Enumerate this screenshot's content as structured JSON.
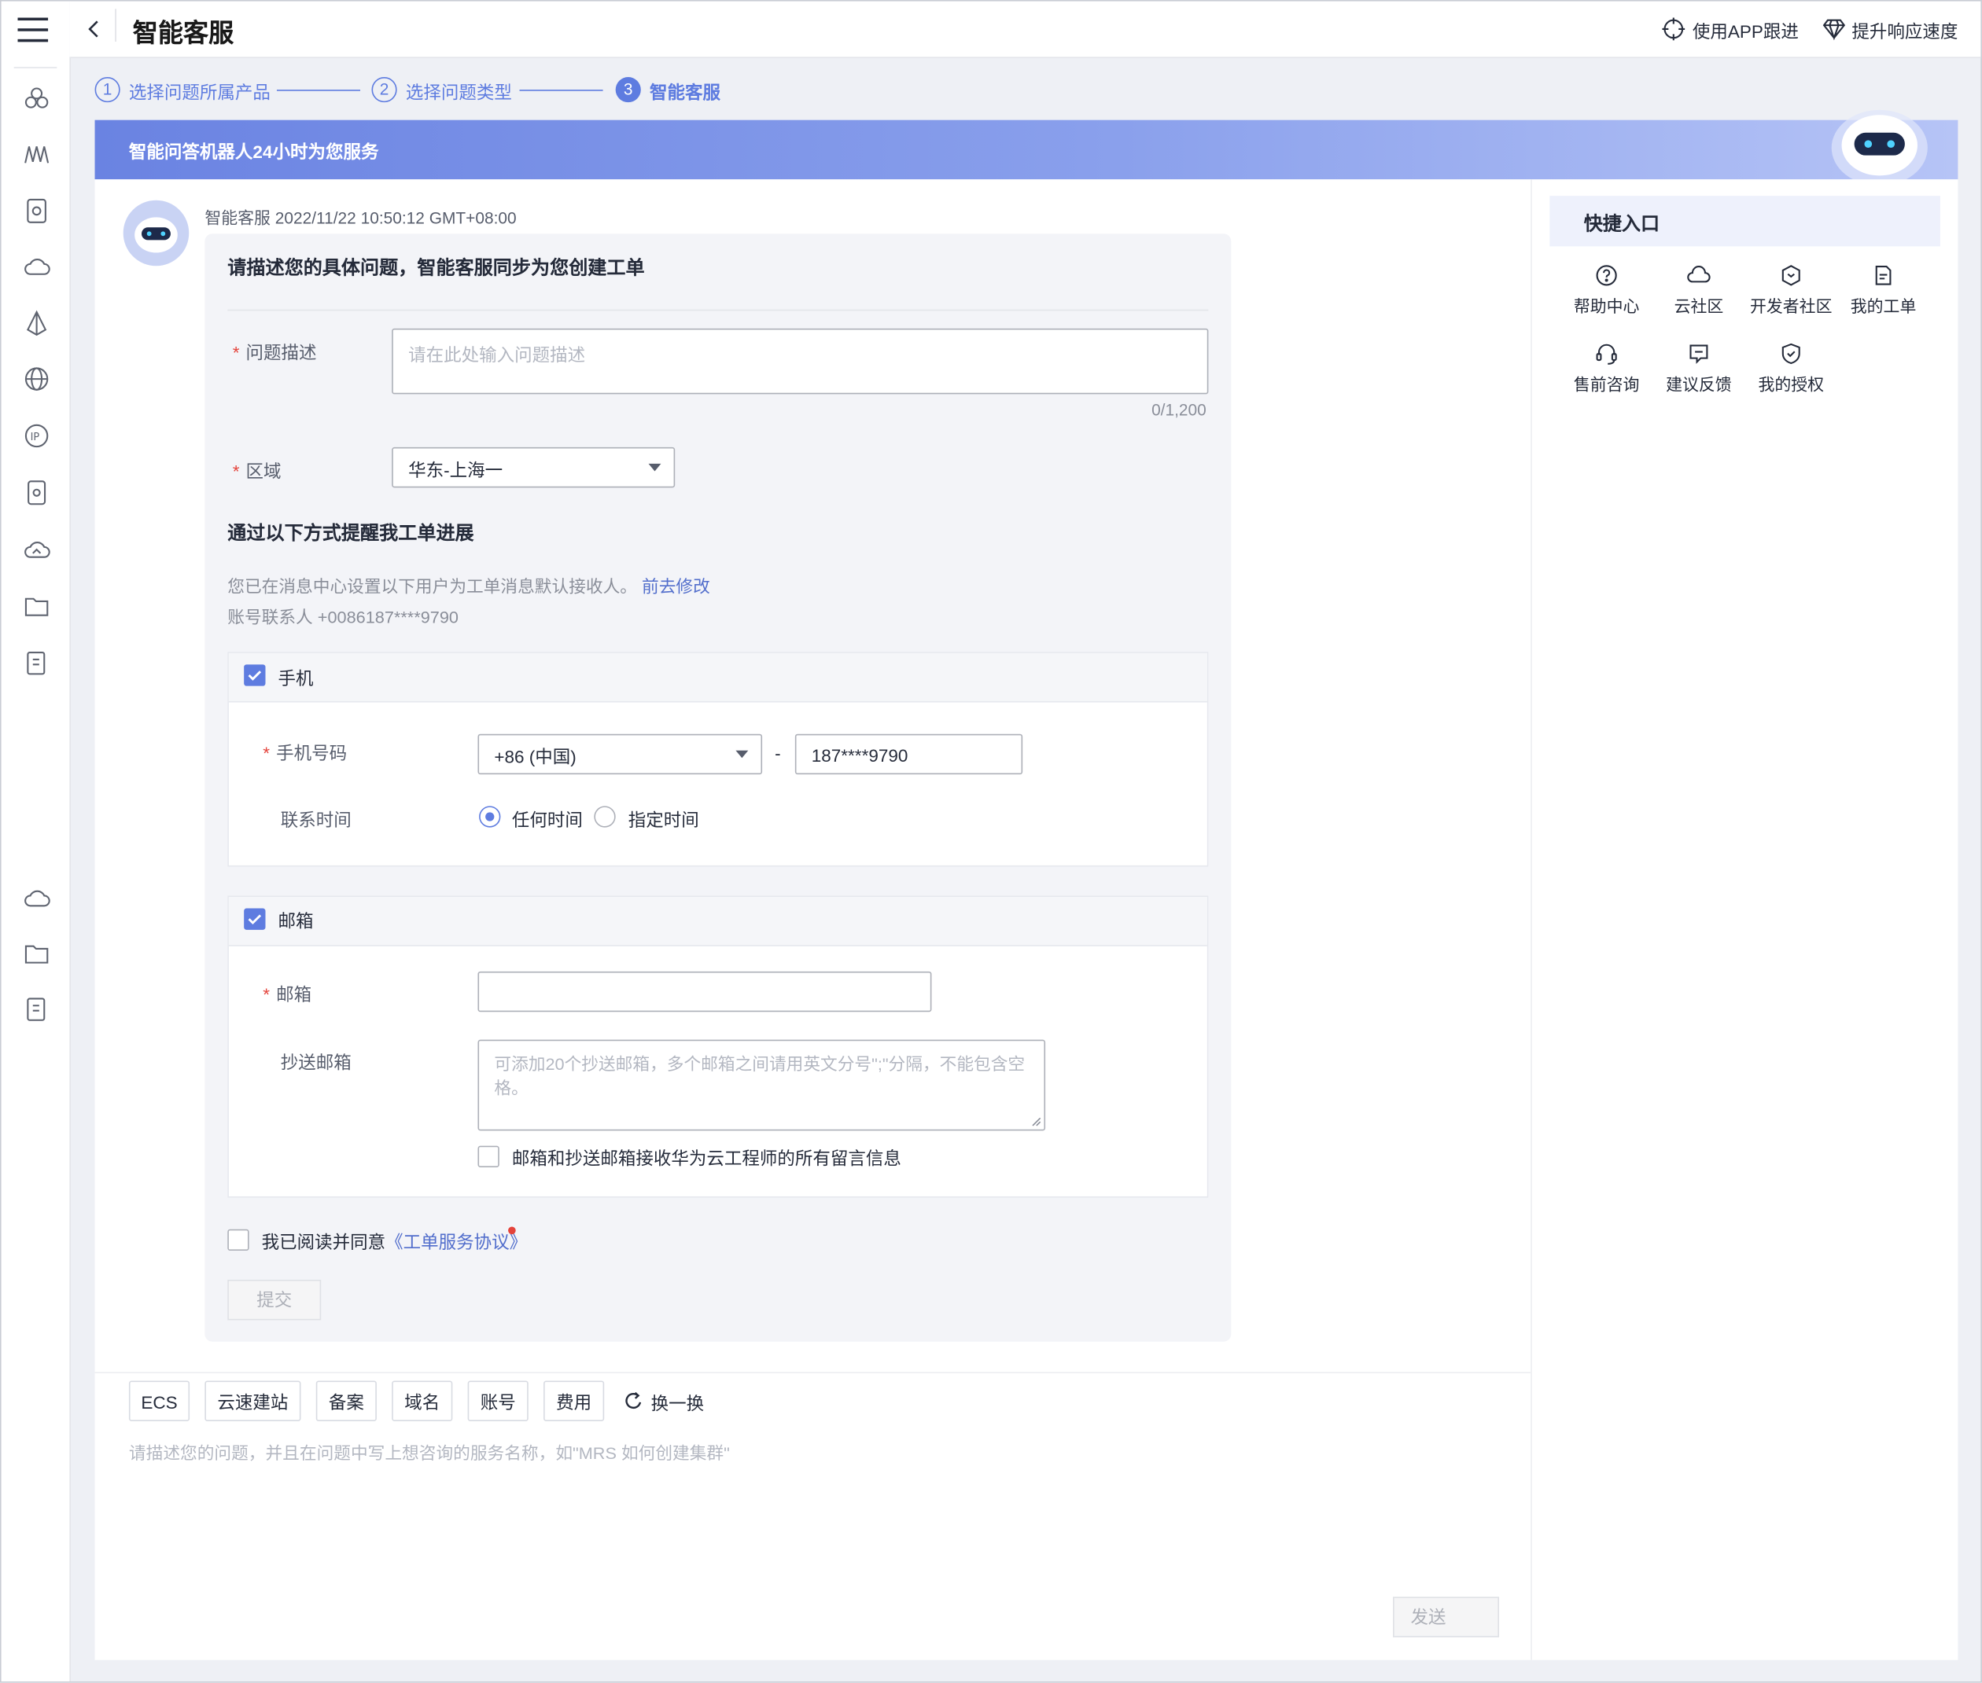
{
  "header": {
    "title": "智能客服",
    "links": [
      "使用APP跟进",
      "提升响应速度"
    ]
  },
  "steps": [
    {
      "num": "1",
      "label": "选择问题所属产品"
    },
    {
      "num": "2",
      "label": "选择问题类型"
    },
    {
      "num": "3",
      "label": "智能客服"
    }
  ],
  "banner": {
    "text": "智能问答机器人24小时为您服务"
  },
  "message": {
    "sender": "智能客服",
    "time": "2022/11/22 10:50:12 GMT+08:00"
  },
  "form": {
    "heading": "请描述您的具体问题，智能客服同步为您创建工单",
    "desc_label": "问题描述",
    "desc_placeholder": "请在此处输入问题描述",
    "desc_count": "0/1,200",
    "region_label": "区域",
    "region_value": "华东-上海一",
    "notify_heading": "通过以下方式提醒我工单进展",
    "notify_note": "您已在消息中心设置以下用户为工单消息默认接收人。",
    "notify_link": "前去修改",
    "notify_contact": "账号联系人 +0086187****9790",
    "phone": {
      "section_label": "手机",
      "checked": true,
      "number_label": "手机号码",
      "country_code": "+86 (中国)",
      "dash": "-",
      "number": "187****9790",
      "time_label": "联系时间",
      "options": [
        "任何时间",
        "指定时间"
      ],
      "selected": "任何时间"
    },
    "email": {
      "section_label": "邮箱",
      "checked": true,
      "email_label": "邮箱",
      "email_value": "",
      "cc_label": "抄送邮箱",
      "cc_placeholder": "可添加20个抄送邮箱，多个邮箱之间请用英文分号\";\"分隔，不能包含空格。",
      "cc_check_label": "邮箱和抄送邮箱接收华为云工程师的所有留言信息"
    },
    "agree_text": "我已阅读并同意",
    "agree_link": "《工单服务协议》",
    "submit": "提交"
  },
  "chat": {
    "tags": [
      "ECS",
      "云速建站",
      "备案",
      "域名",
      "账号",
      "费用"
    ],
    "refresh": "换一换",
    "placeholder": "请描述您的问题，并且在问题中写上想咨询的服务名称，如\"MRS 如何创建集群\"",
    "send": "发送"
  },
  "quick": {
    "title": "快捷入口",
    "items": [
      {
        "label": "帮助中心",
        "icon": "help-icon"
      },
      {
        "label": "云社区",
        "icon": "cloud-icon"
      },
      {
        "label": "开发者社区",
        "icon": "developer-icon"
      },
      {
        "label": "我的工单",
        "icon": "ticket-icon"
      },
      {
        "label": "售前咨询",
        "icon": "headset-icon"
      },
      {
        "label": "建议反馈",
        "icon": "feedback-icon"
      },
      {
        "label": "我的授权",
        "icon": "shield-icon"
      }
    ]
  },
  "colors": {
    "accent": "#5e7ce0",
    "required": "#e4433b",
    "link": "#526ecc"
  }
}
